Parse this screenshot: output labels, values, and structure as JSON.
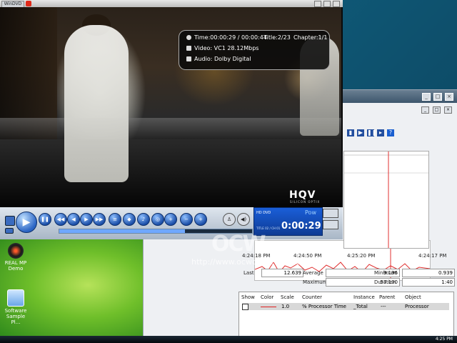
{
  "player": {
    "logo_label": "WinDVD",
    "osd": {
      "time_label": "Time:00:00:29 / 00:00:44",
      "title_label": "Title:2/23",
      "chapter_label": "Chapter:1/1",
      "video_label": "Video: VC1 28.12Mbps",
      "audio_label": "Audio: Dolby Digital"
    },
    "watermark_hqv": "HQV",
    "watermark_hqv_sub": "SILICON OPTIX",
    "display": {
      "format": "HD DVD",
      "state": "Pow",
      "time": "0:00:29",
      "title_chapter": "TITLE 02 / CH 01"
    },
    "progress_fraction": 0.65
  },
  "perfmon": {
    "toolbar_help": "?",
    "timeline_ticks": [
      "4:24:18 PM",
      "4:24:50 PM",
      "4:25:20 PM",
      "4:24:17 PM"
    ],
    "stats": {
      "last_label": "Last",
      "last_value": "12.639",
      "average_label": "Average",
      "average_value": "9.196",
      "minimum_label": "Minimum",
      "minimum_value": "0.939",
      "maximum_label": "Maximum",
      "maximum_value": "57.100",
      "duration_label": "Duration",
      "duration_value": "1:40"
    },
    "columns": [
      "Show",
      "Color",
      "Scale",
      "Counter",
      "Instance",
      "Parent",
      "Object"
    ],
    "counter_row": {
      "scale": "1.0",
      "counter": "% Processor Time",
      "instance": "_Total",
      "parent": "---",
      "object": "Processor"
    }
  },
  "desktop": {
    "icons": [
      {
        "label": "REAL MP Demo"
      },
      {
        "label": "Software Sample Pl..."
      }
    ]
  },
  "watermark": {
    "logo": "OCW",
    "url": "http://www.ocworkbench.com"
  },
  "taskbar": {
    "clock": "4:25 PM"
  }
}
